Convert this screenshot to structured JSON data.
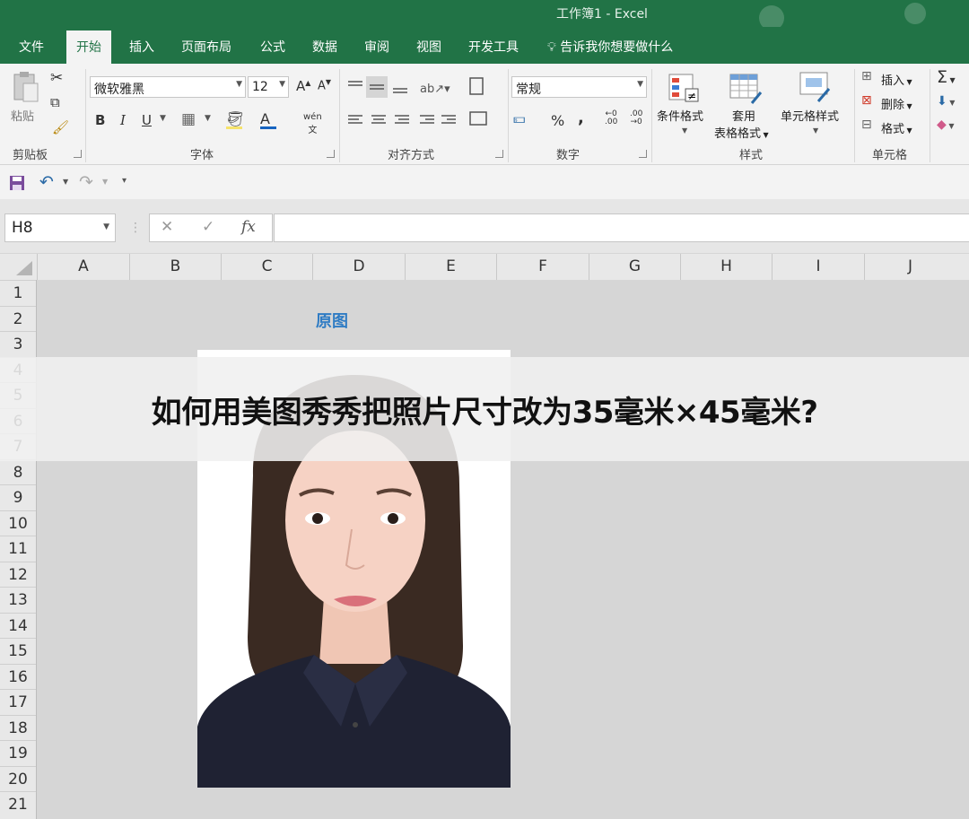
{
  "window": {
    "title": "工作簿1  -  Excel"
  },
  "ribbon_tabs": [
    "文件",
    "开始",
    "插入",
    "页面布局",
    "公式",
    "数据",
    "审阅",
    "视图",
    "开发工具"
  ],
  "active_tab": "开始",
  "tell_me": "告诉我你想要做什么",
  "clipboard": {
    "paste": "粘贴",
    "group": "剪贴板"
  },
  "font": {
    "name": "微软雅黑",
    "size": "12",
    "group": "字体",
    "bold": "B",
    "italic": "I",
    "underline": "U",
    "grow": "A",
    "shrink": "A",
    "color_a": "A",
    "phonetic": "wén"
  },
  "alignment": {
    "group": "对齐方式"
  },
  "number": {
    "format": "常规",
    "group": "数字",
    "percent": "%",
    "comma": ",",
    "inc_dec": ".0",
    "dec_dec": ".00"
  },
  "styles": {
    "conditional": "条件格式",
    "table_line1": "套用",
    "table_line2": "表格格式",
    "cell_styles": "单元格样式",
    "group": "样式"
  },
  "cells": {
    "insert": "插入",
    "delete": "删除",
    "format": "格式",
    "group": "单元格"
  },
  "editing": {
    "sum": "Σ"
  },
  "formula_bar": {
    "name_box": "H8",
    "cancel": "✕",
    "enter": "✓",
    "fx": "fx",
    "value": ""
  },
  "columns": [
    "A",
    "B",
    "C",
    "D",
    "E",
    "F",
    "G",
    "H",
    "I",
    "J"
  ],
  "rows": [
    "1",
    "2",
    "3",
    "4",
    "5",
    "6",
    "7",
    "8",
    "9",
    "10",
    "11",
    "12",
    "13",
    "14",
    "15",
    "16",
    "17",
    "18",
    "19",
    "20",
    "21"
  ],
  "cell_D2": "原图",
  "overlay_headline": "如何用美图秀秀把照片尺寸改为35毫米×45毫米?",
  "colors": {
    "excel_green": "#217346",
    "ribbon_bg": "#f3f3f3",
    "accent_blue": "#2f7cc4"
  }
}
